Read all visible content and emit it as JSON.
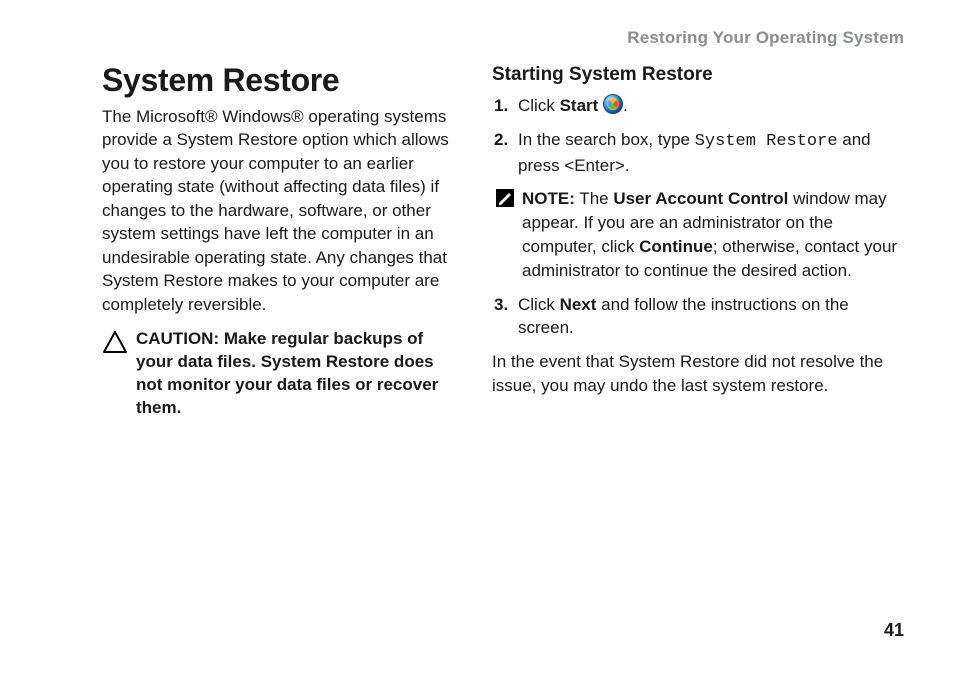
{
  "header": {
    "section": "Restoring Your Operating System"
  },
  "page_number": "41",
  "left": {
    "title": "System Restore",
    "intro": "The Microsoft® Windows® operating systems provide a System Restore option which allows you to restore your computer to an earlier operating state (without affecting data files) if changes to the hardware, software, or other system settings have left the computer in an undesirable operating state. Any changes that System Restore makes to your computer are completely reversible.",
    "caution": "CAUTION: Make regular backups of your data files. System Restore does not monitor your data files or recover them."
  },
  "right": {
    "subtitle": "Starting System Restore",
    "step1_a": "Click ",
    "step1_b": "Start",
    "step1_c": " ",
    "step1_d": ".",
    "step2_a": "In the search box, type ",
    "step2_code": "System Restore",
    "step2_b": " and press <Enter>.",
    "note_label": "NOTE:",
    "note_a": " The ",
    "note_b": "User Account Control",
    "note_c": " window may appear. If you are an administrator on the computer, click ",
    "note_d": "Continue",
    "note_e": "; otherwise, contact your administrator to continue the desired action.",
    "step3_a": "Click ",
    "step3_b": "Next",
    "step3_c": " and follow the instructions on the screen.",
    "closing": "In the event that System Restore did not resolve the issue, you may undo the last system restore."
  }
}
